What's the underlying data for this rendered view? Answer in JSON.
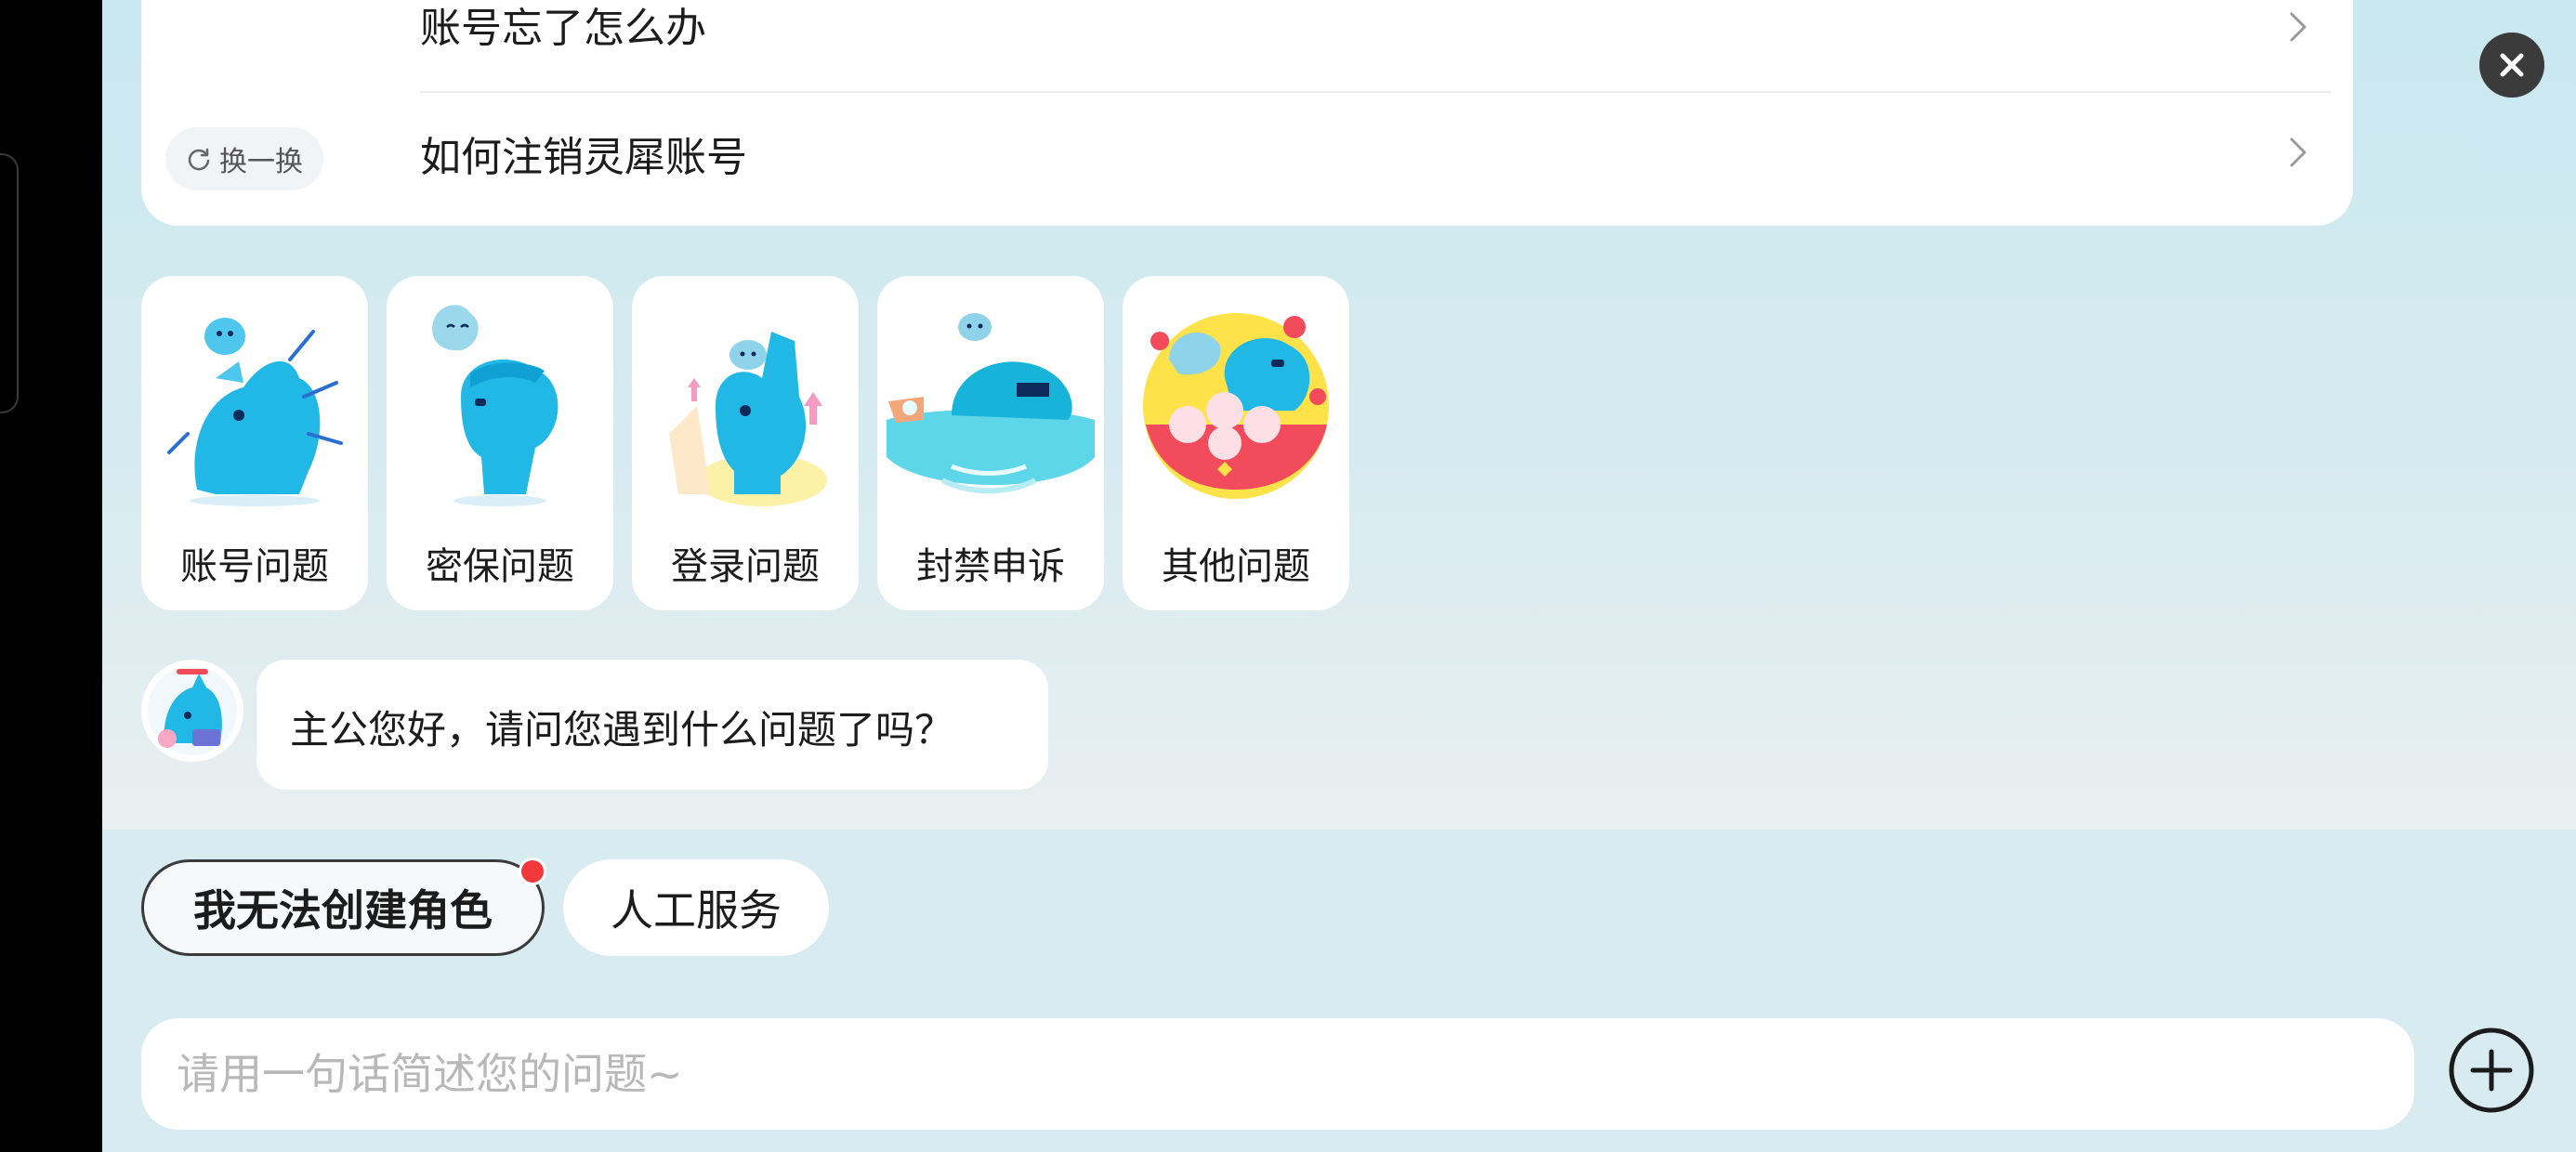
{
  "faq": {
    "items": [
      {
        "label": "账号忘了怎么办"
      },
      {
        "label": "如何注销灵犀账号"
      }
    ],
    "shuffle_label": "换一换"
  },
  "categories": [
    {
      "label": "账号问题",
      "icon": "mascot-account-icon"
    },
    {
      "label": "密保问题",
      "icon": "mascot-security-icon"
    },
    {
      "label": "登录问题",
      "icon": "mascot-login-icon"
    },
    {
      "label": "封禁申诉",
      "icon": "mascot-ban-appeal-icon"
    },
    {
      "label": "其他问题",
      "icon": "mascot-other-icon"
    }
  ],
  "chat": {
    "bot_message": "主公您好，请问您遇到什么问题了吗？"
  },
  "quick_replies": [
    {
      "label": "我无法创建角色",
      "has_notification": true
    },
    {
      "label": "人工服务",
      "has_notification": false
    }
  ],
  "input": {
    "placeholder": "请用一句话简述您的问题~",
    "value": ""
  },
  "colors": {
    "accent_red": "#f23838",
    "mascot_blue": "#22b8e6",
    "background_top": "#c9e8f1"
  }
}
